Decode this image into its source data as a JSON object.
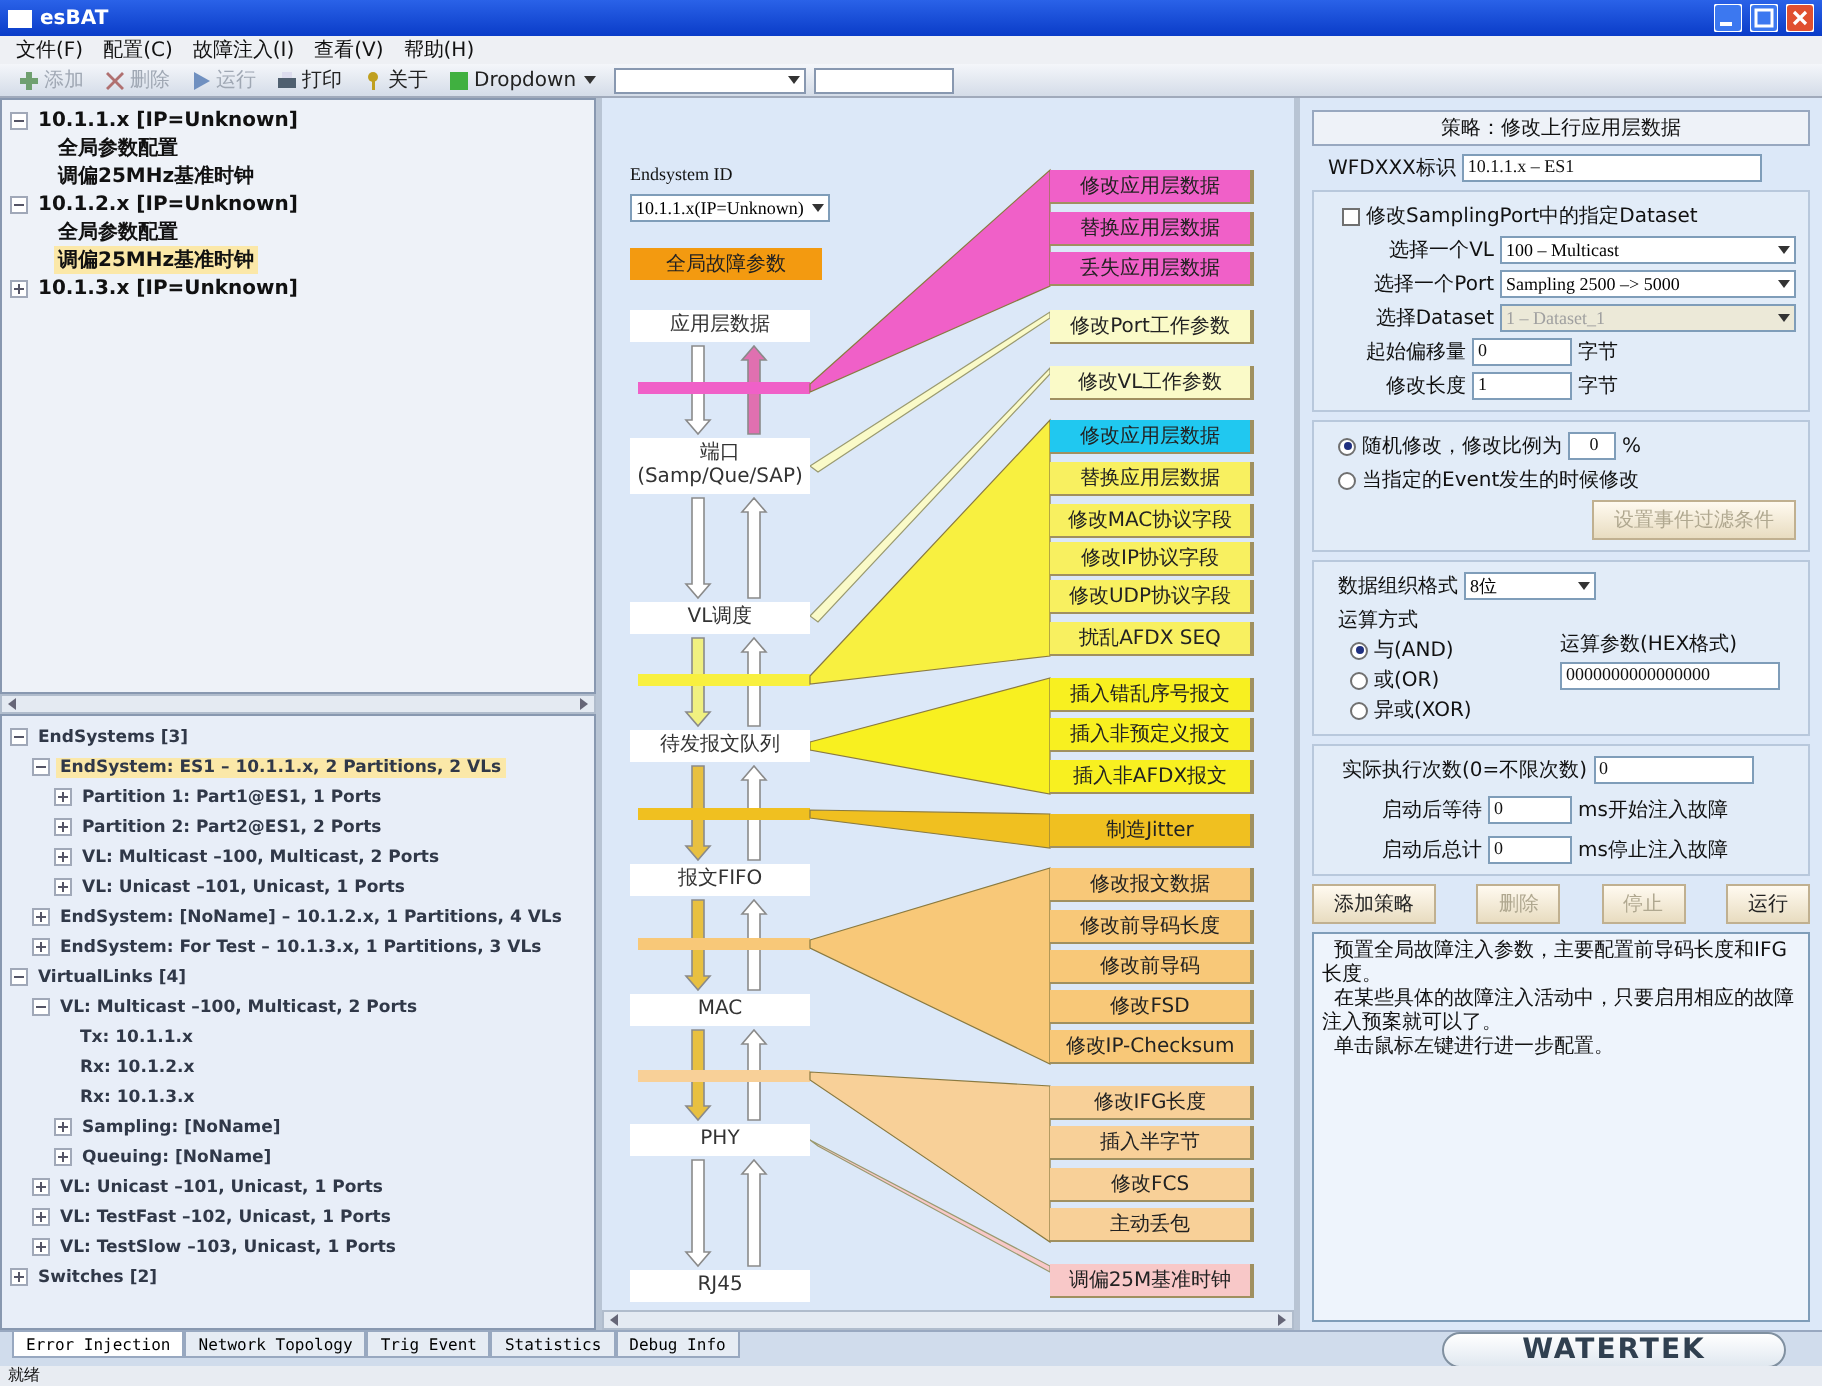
{
  "window": {
    "title": "esBAT"
  },
  "menu": [
    "文件(F)",
    "配置(C)",
    "故障注入(I)",
    "查看(V)",
    "帮助(H)"
  ],
  "toolbar": [
    {
      "kind": "add",
      "label": "添加",
      "disabled": true
    },
    {
      "kind": "delete",
      "label": "删除",
      "disabled": true
    },
    {
      "kind": "run",
      "label": "运行",
      "disabled": true
    },
    {
      "kind": "print",
      "label": "打印",
      "disabled": false
    },
    {
      "kind": "about",
      "label": "关于",
      "disabled": false
    },
    {
      "kind": "dropdown",
      "label": "Dropdown",
      "disabled": false
    }
  ],
  "host_tree": [
    {
      "label": "10.1.1.x [IP=Unknown]",
      "expanded": true,
      "selected": false,
      "children": [
        {
          "label": "全局参数配置",
          "selected": false
        },
        {
          "label": "调偏25MHz基准时钟",
          "selected": false
        }
      ]
    },
    {
      "label": "10.1.2.x [IP=Unknown]",
      "expanded": true,
      "selected": false,
      "children": [
        {
          "label": "全局参数配置",
          "selected": false
        },
        {
          "label": "调偏25MHz基准时钟",
          "selected": true
        }
      ]
    },
    {
      "label": "10.1.3.x [IP=Unknown]",
      "expanded": false,
      "selected": false
    }
  ],
  "network_tree": [
    {
      "label": "EndSystems [3]",
      "expanded": true,
      "selected": false,
      "children": [
        {
          "label": "EndSystem: ES1 – 10.1.1.x, 2 Partitions, 2 VLs",
          "expanded": true,
          "selected": true,
          "children": [
            {
              "label": "Partition 1: Part1@ES1, 1 Ports",
              "expanded": false,
              "selected": false
            },
            {
              "label": "Partition 2: Part2@ES1, 2 Ports",
              "expanded": false,
              "selected": false
            },
            {
              "label": "VL: Multicast –100, Multicast, 2 Ports",
              "expanded": false,
              "selected": false
            },
            {
              "label": "VL: Unicast –101, Unicast, 1 Ports",
              "expanded": false,
              "selected": false
            }
          ]
        },
        {
          "label": "EndSystem: [NoName] – 10.1.2.x, 1 Partitions, 4 VLs",
          "expanded": false,
          "selected": false
        },
        {
          "label": "EndSystem: For Test – 10.1.3.x, 1 Partitions, 3 VLs",
          "expanded": false,
          "selected": false
        }
      ]
    },
    {
      "label": "VirtualLinks [4]",
      "expanded": true,
      "selected": false,
      "children": [
        {
          "label": "VL: Multicast –100, Multicast, 2 Ports",
          "expanded": true,
          "selected": false,
          "children": [
            {
              "label": "Tx: 10.1.1.x",
              "selected": false
            },
            {
              "label": "Rx: 10.1.2.x",
              "selected": false
            },
            {
              "label": "Rx: 10.1.3.x",
              "selected": false
            },
            {
              "label": "Sampling: [NoName]",
              "expanded": false,
              "selected": false
            },
            {
              "label": "Queuing: [NoName]",
              "expanded": false,
              "selected": false
            }
          ]
        },
        {
          "label": "VL: Unicast –101, Unicast, 1 Ports",
          "expanded": false,
          "selected": false
        },
        {
          "label": "VL: TestFast –102, Unicast, 1 Ports",
          "expanded": false,
          "selected": false
        },
        {
          "label": "VL: TestSlow –103, Unicast, 1 Ports",
          "expanded": false,
          "selected": false
        }
      ]
    },
    {
      "label": "Switches [2]",
      "expanded": false,
      "selected": false
    }
  ],
  "diagram": {
    "endsystem_label": "Endsystem ID",
    "endsystem_value": "10.1.1.x(IP=Unknown)",
    "global_button": "全局故障参数",
    "layers": [
      "应用层数据",
      "端口\n(Samp/Que/SAP)",
      "VL调度",
      "待发报文队列",
      "报文FIFO",
      "MAC",
      "PHY",
      "RJ45"
    ],
    "groups": [
      {
        "color": "#f060c8",
        "boxes": [
          {
            "label": "修改应用层数据",
            "color": "#f060c8"
          },
          {
            "label": "替换应用层数据",
            "color": "#f060c8"
          },
          {
            "label": "丢失应用层数据",
            "color": "#f060c8"
          }
        ]
      },
      {
        "color": "#fafac8",
        "boxes": [
          {
            "label": "修改Port工作参数",
            "color": "#fafac8"
          }
        ]
      },
      {
        "color": "#fafac8",
        "boxes": [
          {
            "label": "修改VL工作参数",
            "color": "#fafac8"
          }
        ]
      },
      {
        "color": "#f8f040",
        "boxes": [
          {
            "label": "修改应用层数据",
            "color": "#20c8f0"
          },
          {
            "label": "替换应用层数据",
            "color": "#f8f060"
          },
          {
            "label": "修改MAC协议字段",
            "color": "#f8f060"
          },
          {
            "label": "修改IP协议字段",
            "color": "#f8f060"
          },
          {
            "label": "修改UDP协议字段",
            "color": "#f8f060"
          },
          {
            "label": "扰乱AFDX SEQ",
            "color": "#f8f060"
          }
        ]
      },
      {
        "color": "#f8f020",
        "boxes": [
          {
            "label": "插入错乱序号报文",
            "color": "#f8f020"
          },
          {
            "label": "插入非预定义报文",
            "color": "#f8f020"
          },
          {
            "label": "插入非AFDX报文",
            "color": "#f8f020"
          }
        ]
      },
      {
        "color": "#f0c020",
        "boxes": [
          {
            "label": "制造Jitter",
            "color": "#f0c020"
          }
        ]
      },
      {
        "color": "#f8c878",
        "boxes": [
          {
            "label": "修改报文数据",
            "color": "#f8c878"
          },
          {
            "label": "修改前导码长度",
            "color": "#f8c878"
          },
          {
            "label": "修改前导码",
            "color": "#f8c878"
          },
          {
            "label": "修改FSD",
            "color": "#f8c878"
          },
          {
            "label": "修改IP-Checksum",
            "color": "#f8c878"
          }
        ]
      },
      {
        "color": "#f8d098",
        "boxes": [
          {
            "label": "修改IFG长度",
            "color": "#f8d098"
          },
          {
            "label": "插入半字节",
            "color": "#f8d098"
          },
          {
            "label": "修改FCS",
            "color": "#f8d098"
          },
          {
            "label": "主动丢包",
            "color": "#f8d098"
          }
        ]
      },
      {
        "color": "#f8c8c8",
        "boxes": [
          {
            "label": "调偏25M基准时钟",
            "color": "#f8c8c8"
          }
        ]
      }
    ]
  },
  "strategy": {
    "title": "策略：修改上行应用层数据",
    "id_label": "WFDXXX标识",
    "id_value": "10.1.1.x – ES1",
    "dataset_check": {
      "label": "修改SamplingPort中的指定Dataset",
      "checked": false
    },
    "selects": [
      {
        "label": "选择一个VL",
        "value": "100 – Multicast",
        "disabled": false
      },
      {
        "label": "选择一个Port",
        "value": "Sampling 2500 –> 5000",
        "disabled": false
      },
      {
        "label": "选择Dataset",
        "value": "1 – Dataset_1",
        "disabled": true
      }
    ],
    "byte_fields": [
      {
        "label": "起始偏移量",
        "value": "0",
        "unit": "字节"
      },
      {
        "label": "修改长度",
        "value": "1",
        "unit": "字节"
      }
    ],
    "triggers": [
      {
        "label": "随机修改，修改比例为",
        "selected": true,
        "value": "0",
        "unit": "%"
      },
      {
        "label": "当指定的Event发生的时候修改",
        "selected": false
      }
    ],
    "filter_button": {
      "label": "设置事件过滤条件",
      "disabled": true
    },
    "format": {
      "label": "数据组织格式",
      "value": "8位"
    },
    "op_label": "运算方式",
    "operations": [
      {
        "label": "与(AND)",
        "selected": true
      },
      {
        "label": "或(OR)",
        "selected": false
      },
      {
        "label": "异或(XOR)",
        "selected": false
      }
    ],
    "param": {
      "label": "运算参数(HEX格式)",
      "value": "0000000000000000"
    },
    "exec": {
      "label": "实际执行次数(0=不限次数)",
      "value": "0"
    },
    "timers": [
      {
        "label": "启动后等待",
        "value": "0",
        "unit": "ms开始注入故障"
      },
      {
        "label": "启动后总计",
        "value": "0",
        "unit": "ms停止注入故障"
      }
    ],
    "actions": [
      {
        "label": "添加策略",
        "disabled": false
      },
      {
        "label": "删除",
        "disabled": true
      },
      {
        "label": "停止",
        "disabled": true
      },
      {
        "label": "运行",
        "disabled": false
      }
    ],
    "description": [
      "预置全局故障注入参数，主要配置前导码长度和IFG长度。",
      "在某些具体的故障注入活动中，只要启用相应的故障注入预案就可以了。",
      "单击鼠标左键进行进一步配置。"
    ]
  },
  "bottom_tabs": [
    {
      "label": "Error Injection",
      "selected": true
    },
    {
      "label": "Network Topology",
      "selected": false
    },
    {
      "label": "Trig Event",
      "selected": false
    },
    {
      "label": "Statistics",
      "selected": false
    },
    {
      "label": "Debug Info",
      "selected": false
    }
  ],
  "logo": "WATERTEK",
  "status": "就绪"
}
